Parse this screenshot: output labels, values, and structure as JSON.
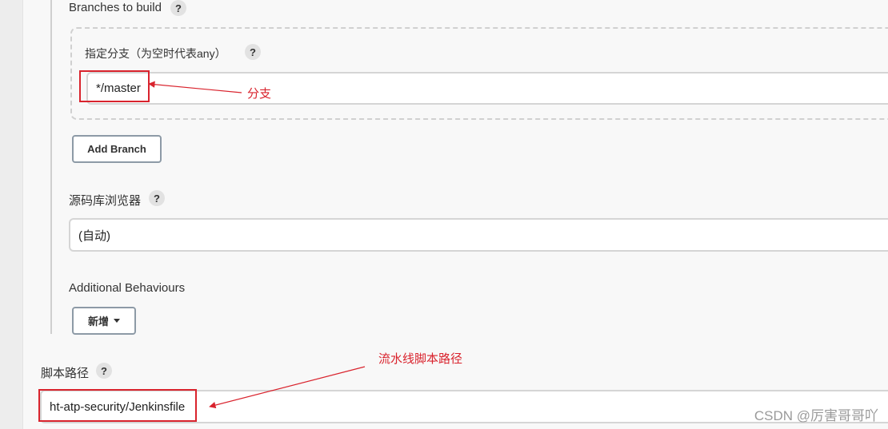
{
  "branches": {
    "label": "Branches to build",
    "specifier_label": "指定分支（为空时代表any）",
    "specifier_value": "*/master",
    "add_branch_label": "Add Branch"
  },
  "repo_browser": {
    "label": "源码库浏览器",
    "value": "(自动)"
  },
  "additional_behaviours": {
    "label": "Additional Behaviours",
    "add_label": "新增"
  },
  "script_path": {
    "label": "脚本路径",
    "value": "ht-atp-security/Jenkinsfile"
  },
  "help_icon_text": "?",
  "annotations": {
    "branch_note": "分支",
    "script_note": "流水线脚本路径",
    "color": "#d9232d"
  },
  "watermark": "CSDN @厉害哥哥吖"
}
